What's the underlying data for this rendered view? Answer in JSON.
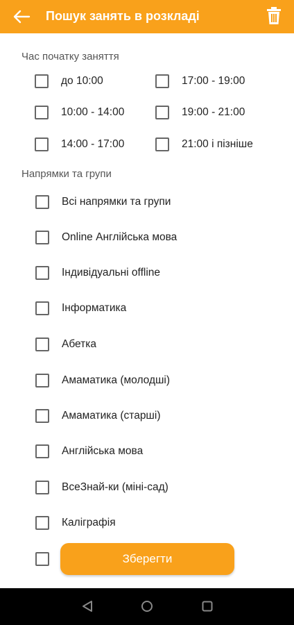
{
  "header": {
    "title": "Пошук занять в розкладі",
    "back_icon": "arrow-left-icon",
    "delete_icon": "trash-icon"
  },
  "time_section": {
    "title": "Час початку заняття",
    "options": [
      {
        "label": "до 10:00",
        "checked": false
      },
      {
        "label": "17:00 - 19:00",
        "checked": false
      },
      {
        "label": "10:00 - 14:00",
        "checked": false
      },
      {
        "label": "19:00 - 21:00",
        "checked": false
      },
      {
        "label": "14:00 - 17:00",
        "checked": false
      },
      {
        "label": "21:00 і пізніше",
        "checked": false
      }
    ]
  },
  "groups_section": {
    "title": "Напрямки та групи",
    "options": [
      {
        "label": "Всі напрямки та групи",
        "checked": false
      },
      {
        "label": "Online Англійська мова",
        "checked": false
      },
      {
        "label": "Індивідуальні offline",
        "checked": false
      },
      {
        "label": "Інформатика",
        "checked": false
      },
      {
        "label": "Абетка",
        "checked": false
      },
      {
        "label": "Амаматика (молодші)",
        "checked": false
      },
      {
        "label": "Амаматика (старші)",
        "checked": false
      },
      {
        "label": "Англійська мова",
        "checked": false
      },
      {
        "label": "ВсеЗнай-ки (міні-сад)",
        "checked": false
      },
      {
        "label": "Каліграфія",
        "checked": false
      },
      {
        "label": "",
        "checked": false
      }
    ]
  },
  "save_button": {
    "label": "Зберегти"
  },
  "colors": {
    "accent": "#F9A11B",
    "navbar": "#000000"
  },
  "system_nav": {
    "icons": [
      "back-triangle-icon",
      "home-circle-icon",
      "recents-square-icon"
    ]
  }
}
